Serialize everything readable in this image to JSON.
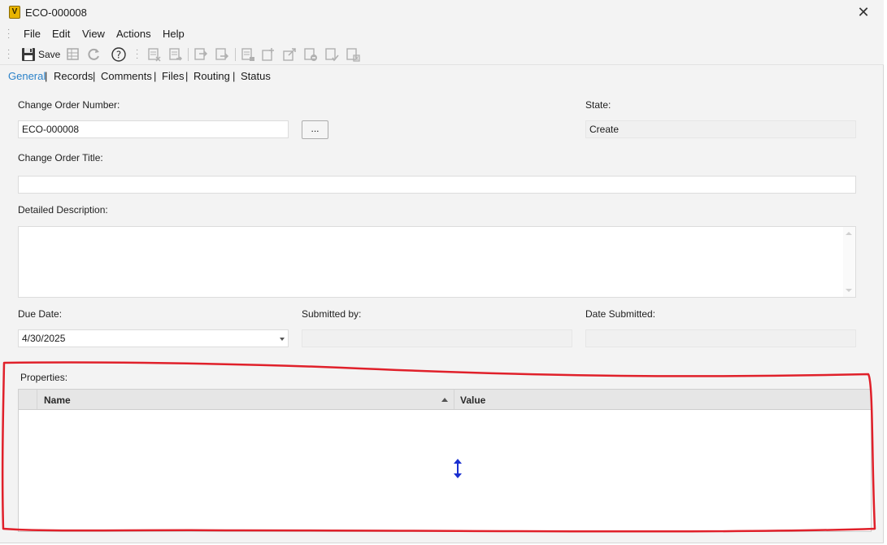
{
  "window": {
    "title": "ECO-000008",
    "app_icon_letter": "V",
    "close_glyph": "✕"
  },
  "menu": {
    "items": [
      "File",
      "Edit",
      "View",
      "Actions",
      "Help"
    ]
  },
  "toolbar": {
    "save_label": "Save"
  },
  "tabs": {
    "items": [
      "General",
      "Records",
      "Comments",
      "Files",
      "Routing",
      "Status"
    ],
    "active": "General",
    "separator": "|"
  },
  "form": {
    "change_order_number": {
      "label": "Change Order Number:",
      "value": "ECO-000008"
    },
    "browse_button": "...",
    "state": {
      "label": "State:",
      "value": "Create"
    },
    "change_order_title": {
      "label": "Change Order Title:",
      "value": ""
    },
    "detailed_description": {
      "label": "Detailed Description:",
      "value": ""
    },
    "due_date": {
      "label": "Due Date:",
      "value": "4/30/2025"
    },
    "submitted_by": {
      "label": "Submitted by:",
      "value": ""
    },
    "date_submitted": {
      "label": "Date Submitted:",
      "value": ""
    }
  },
  "properties": {
    "label": "Properties:",
    "columns": [
      "Name",
      "Value"
    ],
    "sort_column": "Name",
    "sort_direction": "ascending",
    "rows": []
  },
  "colors": {
    "active_tab": "#2b82c9",
    "annotation": "#e0202a",
    "cursor": "#1a2fd0"
  }
}
